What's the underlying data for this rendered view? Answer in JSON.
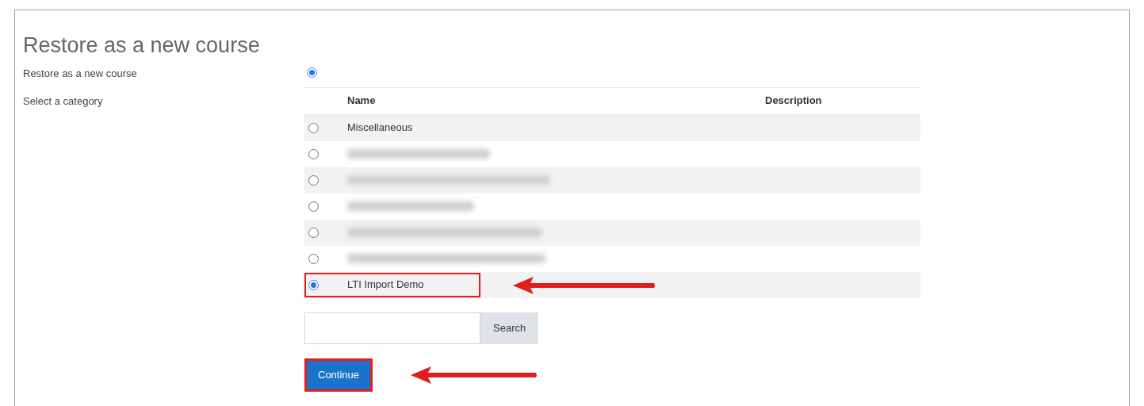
{
  "title": "Restore as a new course",
  "restore_option": {
    "label": "Restore as a new course",
    "selected": true
  },
  "category": {
    "label": "Select a category",
    "columns": [
      "Name",
      "Description"
    ],
    "rows": [
      {
        "kind": "text",
        "name": "Miscellaneous",
        "selected": false,
        "highlighted": false
      },
      {
        "kind": "blurred",
        "selected": false,
        "highlighted": false
      },
      {
        "kind": "blurred",
        "selected": false,
        "highlighted": false
      },
      {
        "kind": "blurred",
        "selected": false,
        "highlighted": false
      },
      {
        "kind": "blurred",
        "selected": false,
        "highlighted": false
      },
      {
        "kind": "blurred",
        "selected": false,
        "highlighted": false
      },
      {
        "kind": "text",
        "name": "LTI Import Demo",
        "selected": true,
        "highlighted": true
      }
    ],
    "search": {
      "button": "Search"
    }
  },
  "continue_button": {
    "label": "Continue",
    "highlighted": true
  }
}
